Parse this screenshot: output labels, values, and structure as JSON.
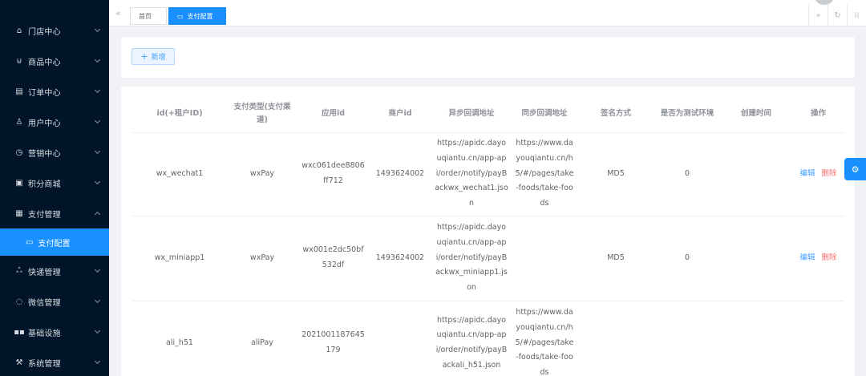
{
  "sidebar": {
    "items": [
      {
        "label": "门店中心",
        "icon": "home-icon"
      },
      {
        "label": "商品中心",
        "icon": "cart-icon"
      },
      {
        "label": "订单中心",
        "icon": "clipboard-icon"
      },
      {
        "label": "用户中心",
        "icon": "user-icon"
      },
      {
        "label": "营销中心",
        "icon": "alarm-icon"
      },
      {
        "label": "积分商城",
        "icon": "shop-icon"
      },
      {
        "label": "支付管理",
        "icon": "calculator-icon",
        "expanded": true
      },
      {
        "label": "快递管理",
        "icon": "bicycle-icon"
      },
      {
        "label": "微信管理",
        "icon": "chat-icon"
      },
      {
        "label": "基础设施",
        "icon": "grid-icon"
      },
      {
        "label": "系统管理",
        "icon": "hammer-icon"
      }
    ],
    "sub_active": {
      "label": "支付配置",
      "icon": "monitor-icon"
    }
  },
  "tabs": {
    "home": "首页",
    "active": "支付配置"
  },
  "toolbar": {
    "add_label": "新增"
  },
  "table": {
    "headers": [
      "id(+租户ID)",
      "支付类型(支付渠道)",
      "应用id",
      "商户id",
      "异步回调地址",
      "同步回调地址",
      "签名方式",
      "是否为测试环境",
      "创建时间",
      "操作"
    ],
    "rows": [
      {
        "id": "wx_wechat1",
        "type": "wxPay",
        "app_id": "wxc061dee8806ff712",
        "merchant_id": "1493624002",
        "async_url": "https://apidc.dayouqiantu.cn/app-api/order/notify/payBackwx_wechat1.json",
        "sync_url": "https://www.dayouqiantu.cn/h5/#/pages/take-foods/take-foods",
        "sign": "MD5",
        "is_test": "0",
        "created": "",
        "edit": "编辑",
        "delete": "删除"
      },
      {
        "id": "wx_miniapp1",
        "type": "wxPay",
        "app_id": "wx001e2dc50bf532df",
        "merchant_id": "1493624002",
        "async_url": "https://apidc.dayouqiantu.cn/app-api/order/notify/payBackwx_miniapp1.json",
        "sync_url": "",
        "sign": "MD5",
        "is_test": "0",
        "created": "",
        "edit": "编辑",
        "delete": "删除"
      },
      {
        "id": "ali_h51",
        "type": "aliPay",
        "app_id": "2021001187645179",
        "merchant_id": "",
        "async_url": "https://apidc.dayouqiantu.cn/app-api/order/notify/payBackali_h51.json",
        "sync_url": "https://www.dayouqiantu.cn/h5/#/pages/take-foods/take-foods",
        "sign": "",
        "is_test": "",
        "created": "",
        "edit": "",
        "delete": ""
      }
    ]
  },
  "colors": {
    "sidebar_bg": "#001529",
    "accent": "#1890ff",
    "danger": "#f56c6c"
  }
}
